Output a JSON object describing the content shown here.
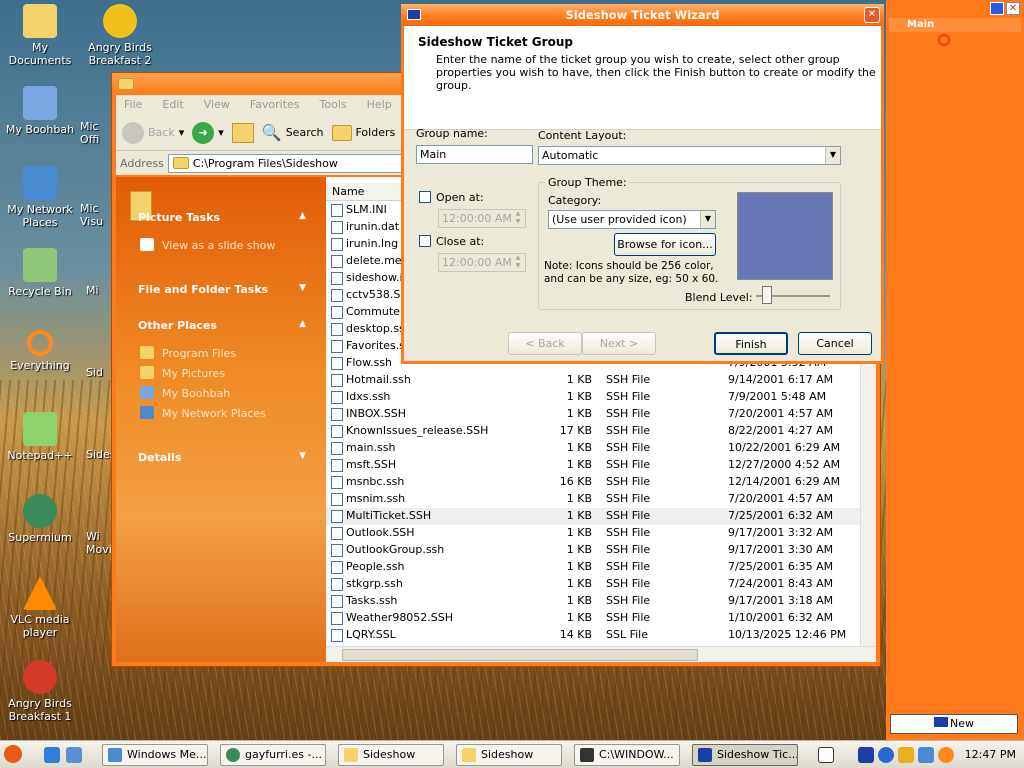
{
  "desktop": {
    "icons": [
      {
        "label": "My Documents",
        "color": "#f5d36b"
      },
      {
        "label": "My Boohbah",
        "color": "#7aa7e0"
      },
      {
        "label": "My Network Places",
        "color": "#4a8ad0"
      },
      {
        "label": "Recycle Bin",
        "color": "#8fc77a"
      },
      {
        "label": "Everything",
        "color": "#ff8a1a"
      },
      {
        "label": "Notepad++",
        "color": "#8fd16a"
      },
      {
        "label": "Supermium",
        "color": "#3a8a5a"
      },
      {
        "label": "VLC media player",
        "color": "#ff8a00"
      },
      {
        "label": "Angry Birds Breakfast 1",
        "color": "#d23a2a"
      },
      {
        "label": "Angry Birds Breakfast 2",
        "color": "#f2c01a"
      }
    ],
    "partial_labels": [
      "Mic Offi",
      "Mic Visu",
      "Mi",
      "Sid",
      "Sidesh",
      "Wi Movi"
    ]
  },
  "explorer": {
    "menu": [
      "File",
      "Edit",
      "View",
      "Favorites",
      "Tools",
      "Help"
    ],
    "toolbar": {
      "back": "Back",
      "search": "Search",
      "folders": "Folders"
    },
    "address_label": "Address",
    "address_value": "C:\\Program Files\\Sideshow",
    "task_pane": {
      "picture_tasks": "Picture Tasks",
      "slideshow": "View as a slide show",
      "file_folder_tasks": "File and Folder Tasks",
      "other_places": "Other Places",
      "places": [
        "Program Files",
        "My Pictures",
        "My Boohbah",
        "My Network Places"
      ],
      "details": "Details"
    },
    "column_name": "Name",
    "top_files": [
      "SLM.INI",
      "irunin.dat",
      "irunin.lng",
      "delete.me",
      "sideshow.in",
      "cctv538.SS",
      "Commute.s",
      "desktop.ssl",
      "Favorites.s"
    ],
    "files": [
      {
        "name": "Flow.ssh",
        "size": "",
        "type": "",
        "date": "7/9/2001 5:52 AM"
      },
      {
        "name": "Hotmail.ssh",
        "size": "1 KB",
        "type": "SSH File",
        "date": "9/14/2001 6:17 AM"
      },
      {
        "name": "Idxs.ssh",
        "size": "1 KB",
        "type": "SSH File",
        "date": "7/9/2001 5:48 AM"
      },
      {
        "name": "INBOX.SSH",
        "size": "1 KB",
        "type": "SSH File",
        "date": "7/20/2001 4:57 AM"
      },
      {
        "name": "KnownIssues_release.SSH",
        "size": "17 KB",
        "type": "SSH File",
        "date": "8/22/2001 4:27 AM"
      },
      {
        "name": "main.ssh",
        "size": "1 KB",
        "type": "SSH File",
        "date": "10/22/2001 6:29 AM"
      },
      {
        "name": "msft.SSH",
        "size": "1 KB",
        "type": "SSH File",
        "date": "12/27/2000 4:52 AM"
      },
      {
        "name": "msnbc.ssh",
        "size": "16 KB",
        "type": "SSH File",
        "date": "12/14/2001 6:29 AM"
      },
      {
        "name": "msnim.ssh",
        "size": "1 KB",
        "type": "SSH File",
        "date": "7/20/2001 4:57 AM"
      },
      {
        "name": "MultiTicket.SSH",
        "size": "1 KB",
        "type": "SSH File",
        "date": "7/25/2001 6:32 AM"
      },
      {
        "name": "Outlook.SSH",
        "size": "1 KB",
        "type": "SSH File",
        "date": "9/17/2001 3:32 AM"
      },
      {
        "name": "OutlookGroup.ssh",
        "size": "1 KB",
        "type": "SSH File",
        "date": "9/17/2001 3:30 AM"
      },
      {
        "name": "People.ssh",
        "size": "1 KB",
        "type": "SSH File",
        "date": "7/25/2001 6:35 AM"
      },
      {
        "name": "stkgrp.ssh",
        "size": "1 KB",
        "type": "SSH File",
        "date": "7/24/2001 8:43 AM"
      },
      {
        "name": "Tasks.ssh",
        "size": "1 KB",
        "type": "SSH File",
        "date": "9/17/2001 3:18 AM"
      },
      {
        "name": "Weather98052.SSH",
        "size": "1 KB",
        "type": "SSH File",
        "date": "1/10/2001 6:32 AM"
      },
      {
        "name": "LQRY.SSL",
        "size": "14 KB",
        "type": "SSL File",
        "date": "10/13/2025 12:46 PM"
      }
    ]
  },
  "wizard": {
    "title": "Sideshow Ticket Wizard",
    "heading": "Sideshow Ticket Group",
    "description": "Enter the name of the ticket group you wish to create, select other group properties you wish to have, then click the Finish button to create or modify the group.",
    "group_name_label": "Group name:",
    "group_name_value": "Main",
    "content_layout_label": "Content Layout:",
    "content_layout_value": "Automatic",
    "open_at_label": "Open at:",
    "open_at_value": "12:00:00 AM",
    "close_at_label": "Close at:",
    "close_at_value": "12:00:00 AM",
    "group_theme_label": "Group Theme:",
    "category_label": "Category:",
    "category_value": "(Use user provided icon)",
    "browse_label": "Browse for icon...",
    "note": "Note: Icons should be 256 color, and can be any size, eg: 50 x 60.",
    "blend_label": "Blend Level:",
    "back_label": "< Back",
    "next_label": "Next >",
    "finish_label": "Finish",
    "cancel_label": "Cancel",
    "preview_color": "#6677b5"
  },
  "side_panel": {
    "tab": "Main",
    "new_label": "New"
  },
  "taskbar": {
    "tasks": [
      "Windows Me...",
      "gayfurri.es -...",
      "Sideshow",
      "Sideshow",
      "C:\\WINDOW...",
      "Sideshow Tic..."
    ],
    "clock": "12:47 PM"
  }
}
